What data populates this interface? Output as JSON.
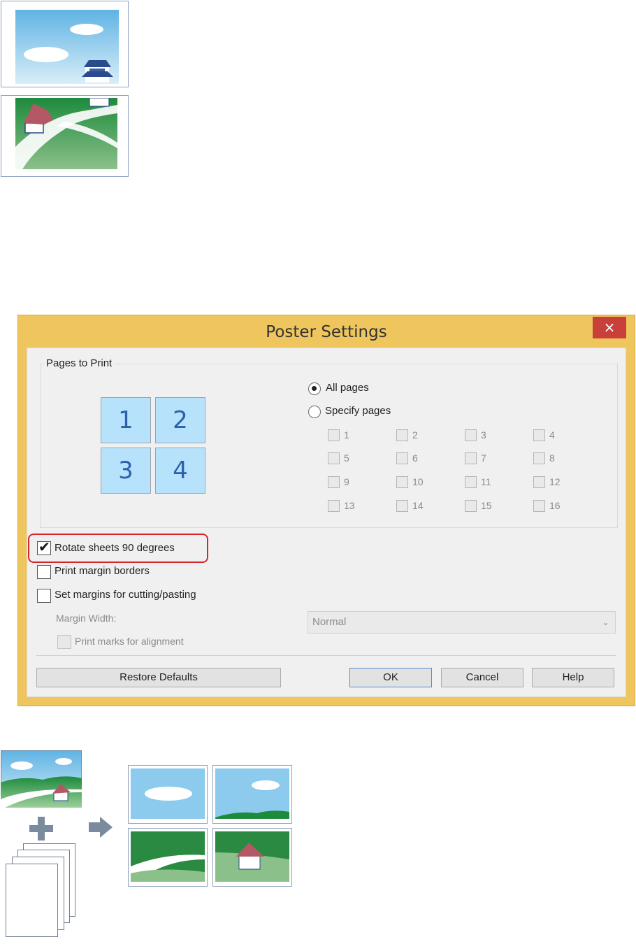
{
  "dialog": {
    "title": "Poster Settings",
    "close_label": "×",
    "group_label": "Pages to Print",
    "tiles": [
      "1",
      "2",
      "3",
      "4"
    ],
    "radio_all": "All pages",
    "radio_specify": "Specify pages",
    "page_numbers": [
      "1",
      "2",
      "3",
      "4",
      "5",
      "6",
      "7",
      "8",
      "9",
      "10",
      "11",
      "12",
      "13",
      "14",
      "15",
      "16"
    ],
    "rotate_label": "Rotate sheets 90 degrees",
    "rotate_checked": true,
    "margin_borders_label": "Print margin borders",
    "set_margins_label": "Set margins for cutting/pasting",
    "margin_width_label": "Margin Width:",
    "margin_width_value": "Normal",
    "print_marks_label": "Print marks for alignment",
    "restore_label": "Restore Defaults",
    "ok_label": "OK",
    "cancel_label": "Cancel",
    "help_label": "Help"
  },
  "colors": {
    "frame": "#efc55d",
    "close": "#c9403a",
    "tile": "#b7e2fb",
    "highlight": "#d6262b"
  }
}
